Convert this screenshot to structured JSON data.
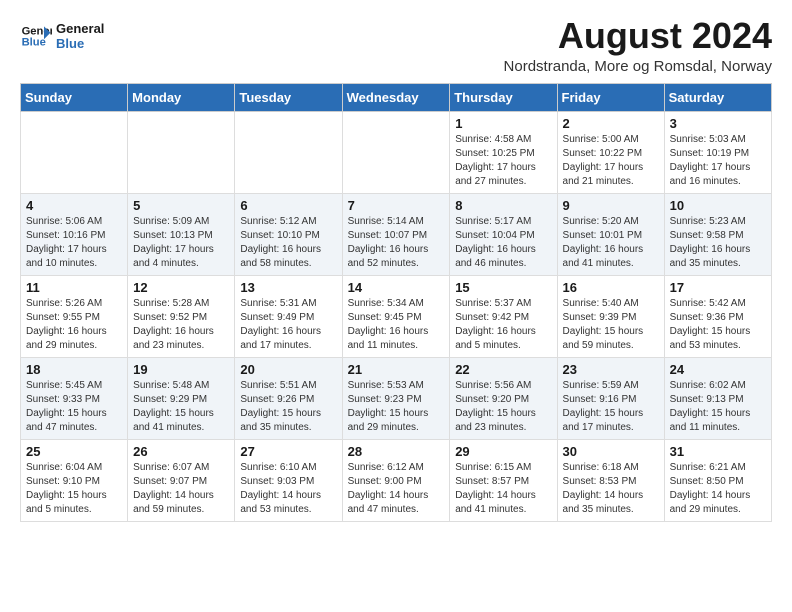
{
  "logo": {
    "line1": "General",
    "line2": "Blue"
  },
  "header": {
    "month_year": "August 2024",
    "location": "Nordstranda, More og Romsdal, Norway"
  },
  "weekdays": [
    "Sunday",
    "Monday",
    "Tuesday",
    "Wednesday",
    "Thursday",
    "Friday",
    "Saturday"
  ],
  "weeks": [
    [
      {
        "day": "",
        "info": ""
      },
      {
        "day": "",
        "info": ""
      },
      {
        "day": "",
        "info": ""
      },
      {
        "day": "",
        "info": ""
      },
      {
        "day": "1",
        "info": "Sunrise: 4:58 AM\nSunset: 10:25 PM\nDaylight: 17 hours\nand 27 minutes."
      },
      {
        "day": "2",
        "info": "Sunrise: 5:00 AM\nSunset: 10:22 PM\nDaylight: 17 hours\nand 21 minutes."
      },
      {
        "day": "3",
        "info": "Sunrise: 5:03 AM\nSunset: 10:19 PM\nDaylight: 17 hours\nand 16 minutes."
      }
    ],
    [
      {
        "day": "4",
        "info": "Sunrise: 5:06 AM\nSunset: 10:16 PM\nDaylight: 17 hours\nand 10 minutes."
      },
      {
        "day": "5",
        "info": "Sunrise: 5:09 AM\nSunset: 10:13 PM\nDaylight: 17 hours\nand 4 minutes."
      },
      {
        "day": "6",
        "info": "Sunrise: 5:12 AM\nSunset: 10:10 PM\nDaylight: 16 hours\nand 58 minutes."
      },
      {
        "day": "7",
        "info": "Sunrise: 5:14 AM\nSunset: 10:07 PM\nDaylight: 16 hours\nand 52 minutes."
      },
      {
        "day": "8",
        "info": "Sunrise: 5:17 AM\nSunset: 10:04 PM\nDaylight: 16 hours\nand 46 minutes."
      },
      {
        "day": "9",
        "info": "Sunrise: 5:20 AM\nSunset: 10:01 PM\nDaylight: 16 hours\nand 41 minutes."
      },
      {
        "day": "10",
        "info": "Sunrise: 5:23 AM\nSunset: 9:58 PM\nDaylight: 16 hours\nand 35 minutes."
      }
    ],
    [
      {
        "day": "11",
        "info": "Sunrise: 5:26 AM\nSunset: 9:55 PM\nDaylight: 16 hours\nand 29 minutes."
      },
      {
        "day": "12",
        "info": "Sunrise: 5:28 AM\nSunset: 9:52 PM\nDaylight: 16 hours\nand 23 minutes."
      },
      {
        "day": "13",
        "info": "Sunrise: 5:31 AM\nSunset: 9:49 PM\nDaylight: 16 hours\nand 17 minutes."
      },
      {
        "day": "14",
        "info": "Sunrise: 5:34 AM\nSunset: 9:45 PM\nDaylight: 16 hours\nand 11 minutes."
      },
      {
        "day": "15",
        "info": "Sunrise: 5:37 AM\nSunset: 9:42 PM\nDaylight: 16 hours\nand 5 minutes."
      },
      {
        "day": "16",
        "info": "Sunrise: 5:40 AM\nSunset: 9:39 PM\nDaylight: 15 hours\nand 59 minutes."
      },
      {
        "day": "17",
        "info": "Sunrise: 5:42 AM\nSunset: 9:36 PM\nDaylight: 15 hours\nand 53 minutes."
      }
    ],
    [
      {
        "day": "18",
        "info": "Sunrise: 5:45 AM\nSunset: 9:33 PM\nDaylight: 15 hours\nand 47 minutes."
      },
      {
        "day": "19",
        "info": "Sunrise: 5:48 AM\nSunset: 9:29 PM\nDaylight: 15 hours\nand 41 minutes."
      },
      {
        "day": "20",
        "info": "Sunrise: 5:51 AM\nSunset: 9:26 PM\nDaylight: 15 hours\nand 35 minutes."
      },
      {
        "day": "21",
        "info": "Sunrise: 5:53 AM\nSunset: 9:23 PM\nDaylight: 15 hours\nand 29 minutes."
      },
      {
        "day": "22",
        "info": "Sunrise: 5:56 AM\nSunset: 9:20 PM\nDaylight: 15 hours\nand 23 minutes."
      },
      {
        "day": "23",
        "info": "Sunrise: 5:59 AM\nSunset: 9:16 PM\nDaylight: 15 hours\nand 17 minutes."
      },
      {
        "day": "24",
        "info": "Sunrise: 6:02 AM\nSunset: 9:13 PM\nDaylight: 15 hours\nand 11 minutes."
      }
    ],
    [
      {
        "day": "25",
        "info": "Sunrise: 6:04 AM\nSunset: 9:10 PM\nDaylight: 15 hours\nand 5 minutes."
      },
      {
        "day": "26",
        "info": "Sunrise: 6:07 AM\nSunset: 9:07 PM\nDaylight: 14 hours\nand 59 minutes."
      },
      {
        "day": "27",
        "info": "Sunrise: 6:10 AM\nSunset: 9:03 PM\nDaylight: 14 hours\nand 53 minutes."
      },
      {
        "day": "28",
        "info": "Sunrise: 6:12 AM\nSunset: 9:00 PM\nDaylight: 14 hours\nand 47 minutes."
      },
      {
        "day": "29",
        "info": "Sunrise: 6:15 AM\nSunset: 8:57 PM\nDaylight: 14 hours\nand 41 minutes."
      },
      {
        "day": "30",
        "info": "Sunrise: 6:18 AM\nSunset: 8:53 PM\nDaylight: 14 hours\nand 35 minutes."
      },
      {
        "day": "31",
        "info": "Sunrise: 6:21 AM\nSunset: 8:50 PM\nDaylight: 14 hours\nand 29 minutes."
      }
    ]
  ]
}
